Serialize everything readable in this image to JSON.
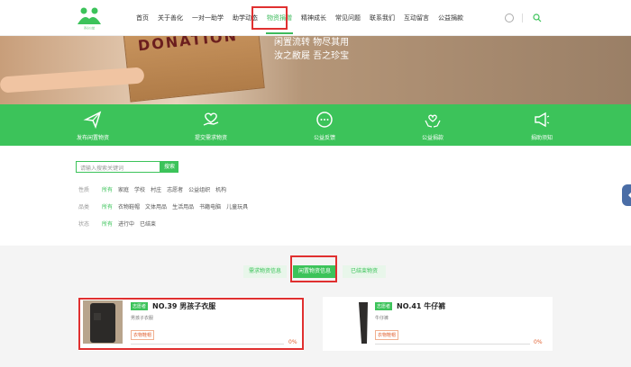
{
  "header": {
    "logo_caption": "善心公益",
    "nav": [
      "首页",
      "关于善化",
      "一对一助学",
      "助学动态",
      "物资捐赠",
      "精神成长",
      "常见问题",
      "联系我们",
      "互动留言",
      "公益捐款"
    ],
    "active_nav": "物资捐赠"
  },
  "banner": {
    "box_text": "DONATION",
    "slogan_line1": "闲置流转 物尽其用",
    "slogan_line2": "汝之敝屣 吾之珍宝"
  },
  "actions": [
    {
      "label": "发布闲置物资",
      "icon": "paper-plane-icon"
    },
    {
      "label": "提交需求物资",
      "icon": "hand-heart-icon"
    },
    {
      "label": "公益反馈",
      "icon": "chat-bubble-icon"
    },
    {
      "label": "公益捐款",
      "icon": "hands-heart-icon"
    },
    {
      "label": "捐助须知",
      "icon": "megaphone-icon"
    }
  ],
  "search": {
    "placeholder": "请输入搜索关键词",
    "button": "搜索"
  },
  "filters": {
    "nature": {
      "label": "性质",
      "options": [
        "所有",
        "家庭",
        "学校",
        "村庄",
        "志愿者",
        "公益组织",
        "机构"
      ]
    },
    "category": {
      "label": "品类",
      "options": [
        "所有",
        "衣物鞋帽",
        "文体用品",
        "生活用品",
        "书籍电脑",
        "儿童玩具"
      ]
    },
    "status": {
      "label": "状态",
      "options": [
        "所有",
        "进行中",
        "已结束"
      ]
    }
  },
  "tabs": [
    "需求物资信息",
    "闲置物资信息",
    "已结束物资"
  ],
  "active_tab": "闲置物资信息",
  "cards": [
    {
      "badge": "志愿者",
      "title": "NO.39 男孩子衣服",
      "subtitle": "男孩子衣服",
      "tag": "衣物鞋帽",
      "progress": "0%",
      "progress_value": 0
    },
    {
      "badge": "志愿者",
      "title": "NO.41 牛仔裤",
      "subtitle": "牛仔裤",
      "tag": "衣物鞋帽",
      "progress": "0%",
      "progress_value": 0
    }
  ],
  "colors": {
    "brand": "#3cc35a",
    "highlight": "#e03030",
    "accent": "#e06030"
  }
}
